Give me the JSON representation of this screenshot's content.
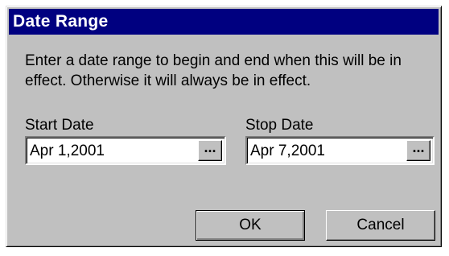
{
  "dialog": {
    "title": "Date Range",
    "message": "Enter a date range to begin and end when this will be in effect. Otherwise it will always be in effect.",
    "start": {
      "label": "Start Date",
      "value": "Apr 1,2001",
      "browse_label": "..."
    },
    "stop": {
      "label": "Stop Date",
      "value": "Apr 7,2001",
      "browse_label": "..."
    },
    "buttons": {
      "ok": "OK",
      "cancel": "Cancel"
    }
  },
  "colors": {
    "titlebar": "#000080",
    "title_text": "#ffffff",
    "face": "#c0c0c0",
    "field_bg": "#ffffff"
  }
}
